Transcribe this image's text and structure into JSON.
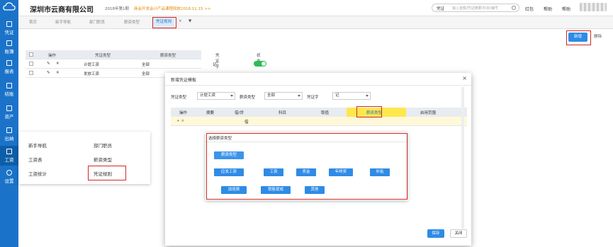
{
  "sidebar": {
    "items": [
      {
        "label": "凭证"
      },
      {
        "label": "账簿"
      },
      {
        "label": "报表"
      },
      {
        "label": "结账"
      },
      {
        "label": "资产"
      },
      {
        "label": "出纳"
      },
      {
        "label": "工资"
      },
      {
        "label": "设置"
      }
    ]
  },
  "header": {
    "company": "深圳市云商有限公司",
    "period": "2018年第1期",
    "notice": "商会开发会计产品课程回放2018.11.15 >>",
    "search_type": "凭证",
    "search_placeholder": "输入金额/凭证摘要/科目/编号",
    "links": [
      "红包",
      "帮助",
      "帮助"
    ]
  },
  "tabs": [
    "首页",
    "新手导航",
    "部门职员",
    "薪资类型",
    "凭证规则"
  ],
  "toolbar": {
    "add_label": "新增",
    "delete_label": "删除"
  },
  "table": {
    "columns": [
      "操作",
      "凭证类型",
      "薪资类型",
      "凭证字",
      "状态"
    ],
    "rows": [
      {
        "voucher_type": "计提工资",
        "salary_type": "全部",
        "word": "记"
      },
      {
        "voucher_type": "发放工资",
        "salary_type": "全部",
        "word": ""
      }
    ]
  },
  "popmenu": {
    "items": [
      "新手导航",
      "部门职员",
      "工资表",
      "薪资类型",
      "工资统计",
      "凭证规则"
    ]
  },
  "dialog": {
    "title": "新增凭证模板",
    "close": "×",
    "labels": {
      "voucher_type": "凭证类型",
      "salary_type": "薪资类型",
      "word": "凭证字"
    },
    "values": {
      "voucher_type": "计提工资",
      "salary_type": "全部",
      "word": "记"
    },
    "grid_columns": [
      "操作",
      "摘要",
      "借/贷",
      "科目",
      "取值",
      "薪资类型",
      "启用范围"
    ],
    "grid_row": {
      "ops": "+  ×",
      "direction": "借"
    },
    "save_label": "保存",
    "close_label": "关闭"
  },
  "subdialog": {
    "title": "选择薪资类型",
    "header_chip": "薪资类型",
    "row1": [
      "应发工资",
      "工资",
      "奖金",
      "年终奖",
      "补贴"
    ],
    "row2": [
      "加班费",
      "销售提成",
      "其他"
    ]
  }
}
